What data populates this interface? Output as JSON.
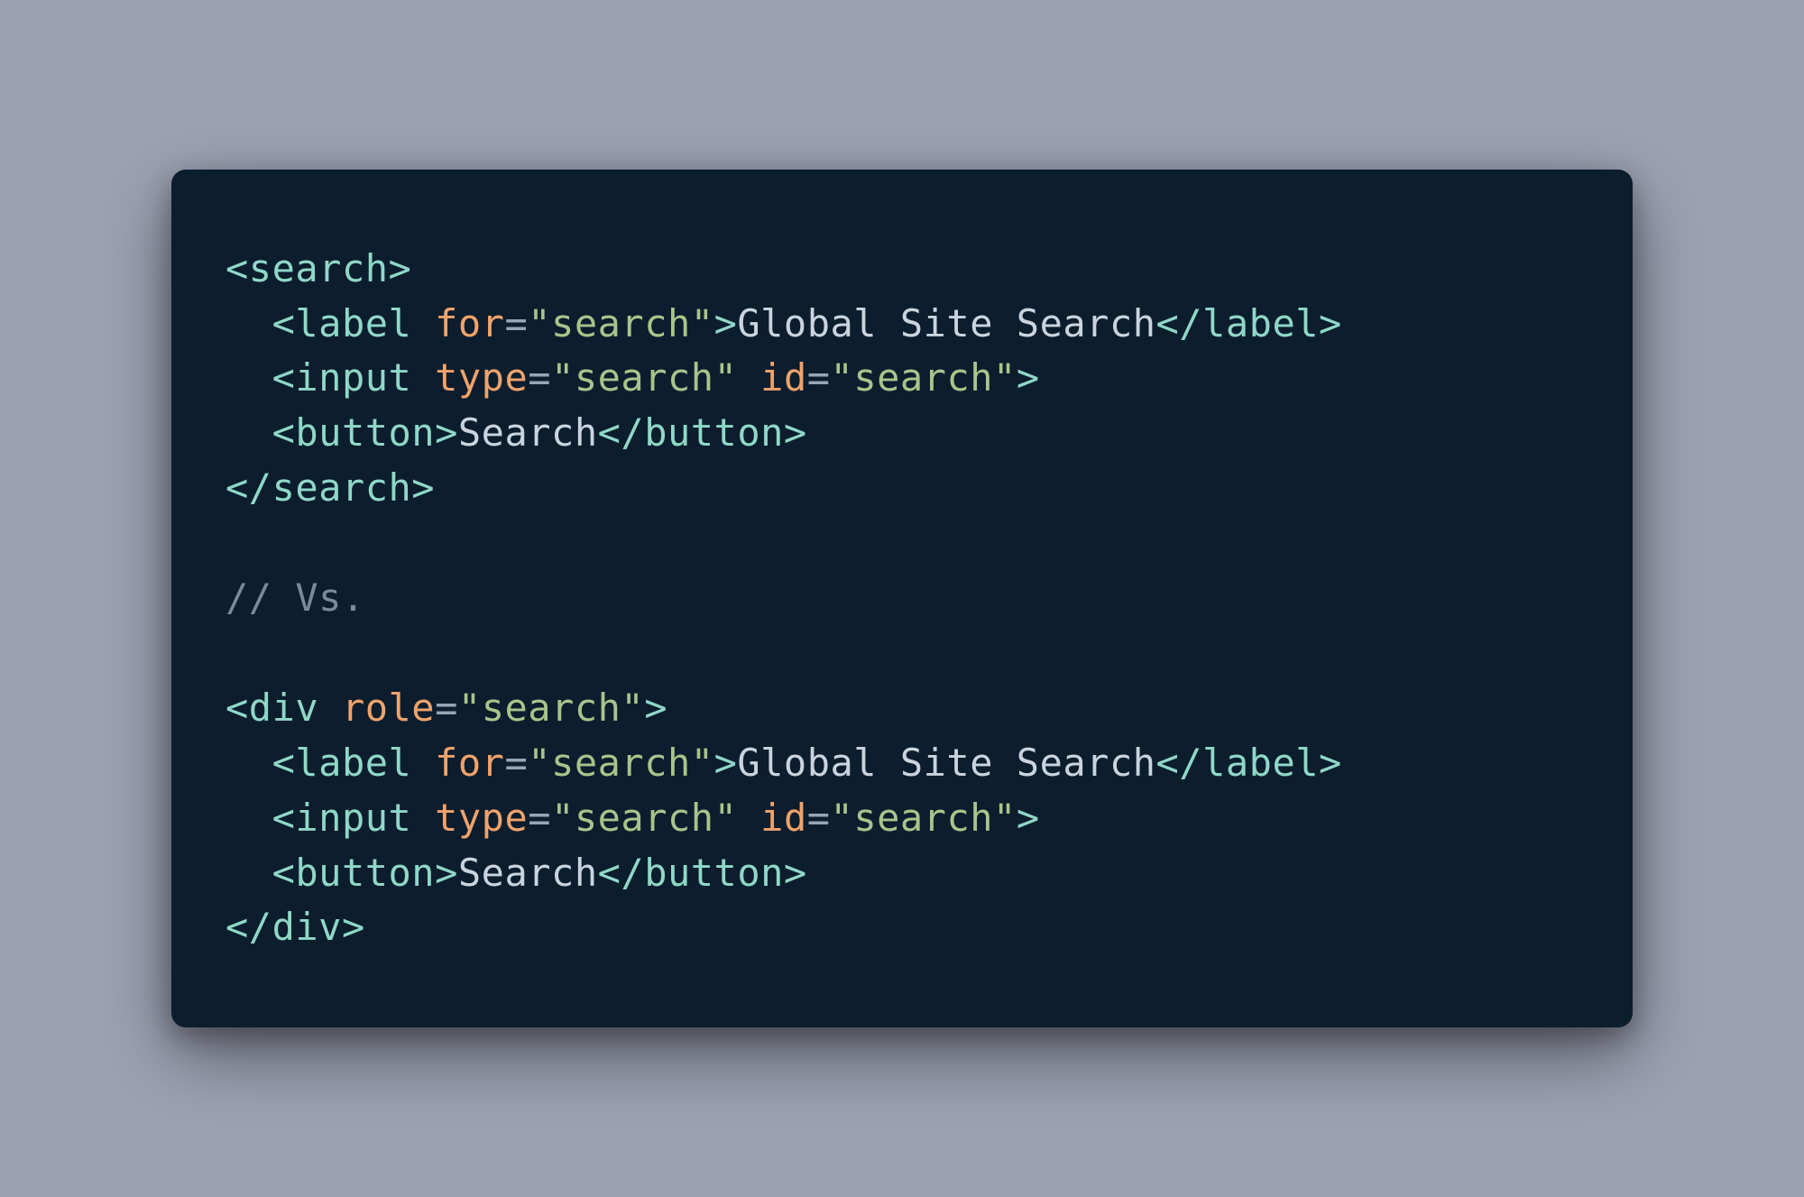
{
  "code": {
    "lines": [
      {
        "indent": 0,
        "tokens": [
          {
            "t": "bracket",
            "v": "<"
          },
          {
            "t": "tag",
            "v": "search"
          },
          {
            "t": "bracket",
            "v": ">"
          }
        ]
      },
      {
        "indent": 1,
        "tokens": [
          {
            "t": "bracket",
            "v": "<"
          },
          {
            "t": "tag",
            "v": "label"
          },
          {
            "t": "text",
            "v": " "
          },
          {
            "t": "attr",
            "v": "for"
          },
          {
            "t": "eq",
            "v": "="
          },
          {
            "t": "str",
            "v": "\"search\""
          },
          {
            "t": "bracket",
            "v": ">"
          },
          {
            "t": "text",
            "v": "Global Site Search"
          },
          {
            "t": "bracket",
            "v": "</"
          },
          {
            "t": "tag",
            "v": "label"
          },
          {
            "t": "bracket",
            "v": ">"
          }
        ]
      },
      {
        "indent": 1,
        "tokens": [
          {
            "t": "bracket",
            "v": "<"
          },
          {
            "t": "tag",
            "v": "input"
          },
          {
            "t": "text",
            "v": " "
          },
          {
            "t": "attr",
            "v": "type"
          },
          {
            "t": "eq",
            "v": "="
          },
          {
            "t": "str",
            "v": "\"search\""
          },
          {
            "t": "text",
            "v": " "
          },
          {
            "t": "attr",
            "v": "id"
          },
          {
            "t": "eq",
            "v": "="
          },
          {
            "t": "str",
            "v": "\"search\""
          },
          {
            "t": "bracket",
            "v": ">"
          }
        ]
      },
      {
        "indent": 1,
        "tokens": [
          {
            "t": "bracket",
            "v": "<"
          },
          {
            "t": "tag",
            "v": "button"
          },
          {
            "t": "bracket",
            "v": ">"
          },
          {
            "t": "text",
            "v": "Search"
          },
          {
            "t": "bracket",
            "v": "</"
          },
          {
            "t": "tag",
            "v": "button"
          },
          {
            "t": "bracket",
            "v": ">"
          }
        ]
      },
      {
        "indent": 0,
        "tokens": [
          {
            "t": "bracket",
            "v": "</"
          },
          {
            "t": "tag",
            "v": "search"
          },
          {
            "t": "bracket",
            "v": ">"
          }
        ]
      },
      {
        "indent": 0,
        "tokens": []
      },
      {
        "indent": 0,
        "tokens": [
          {
            "t": "comment",
            "v": "// Vs."
          }
        ]
      },
      {
        "indent": 0,
        "tokens": []
      },
      {
        "indent": 0,
        "tokens": [
          {
            "t": "bracket",
            "v": "<"
          },
          {
            "t": "tag",
            "v": "div"
          },
          {
            "t": "text",
            "v": " "
          },
          {
            "t": "attr",
            "v": "role"
          },
          {
            "t": "eq",
            "v": "="
          },
          {
            "t": "str",
            "v": "\"search\""
          },
          {
            "t": "bracket",
            "v": ">"
          }
        ]
      },
      {
        "indent": 1,
        "tokens": [
          {
            "t": "bracket",
            "v": "<"
          },
          {
            "t": "tag",
            "v": "label"
          },
          {
            "t": "text",
            "v": " "
          },
          {
            "t": "attr",
            "v": "for"
          },
          {
            "t": "eq",
            "v": "="
          },
          {
            "t": "str",
            "v": "\"search\""
          },
          {
            "t": "bracket",
            "v": ">"
          },
          {
            "t": "text",
            "v": "Global Site Search"
          },
          {
            "t": "bracket",
            "v": "</"
          },
          {
            "t": "tag",
            "v": "label"
          },
          {
            "t": "bracket",
            "v": ">"
          }
        ]
      },
      {
        "indent": 1,
        "tokens": [
          {
            "t": "bracket",
            "v": "<"
          },
          {
            "t": "tag",
            "v": "input"
          },
          {
            "t": "text",
            "v": " "
          },
          {
            "t": "attr",
            "v": "type"
          },
          {
            "t": "eq",
            "v": "="
          },
          {
            "t": "str",
            "v": "\"search\""
          },
          {
            "t": "text",
            "v": " "
          },
          {
            "t": "attr",
            "v": "id"
          },
          {
            "t": "eq",
            "v": "="
          },
          {
            "t": "str",
            "v": "\"search\""
          },
          {
            "t": "bracket",
            "v": ">"
          }
        ]
      },
      {
        "indent": 1,
        "tokens": [
          {
            "t": "bracket",
            "v": "<"
          },
          {
            "t": "tag",
            "v": "button"
          },
          {
            "t": "bracket",
            "v": ">"
          },
          {
            "t": "text",
            "v": "Search"
          },
          {
            "t": "bracket",
            "v": "</"
          },
          {
            "t": "tag",
            "v": "button"
          },
          {
            "t": "bracket",
            "v": ">"
          }
        ]
      },
      {
        "indent": 0,
        "tokens": [
          {
            "t": "bracket",
            "v": "</"
          },
          {
            "t": "tag",
            "v": "div"
          },
          {
            "t": "bracket",
            "v": ">"
          }
        ]
      }
    ],
    "indent_string": "  "
  }
}
